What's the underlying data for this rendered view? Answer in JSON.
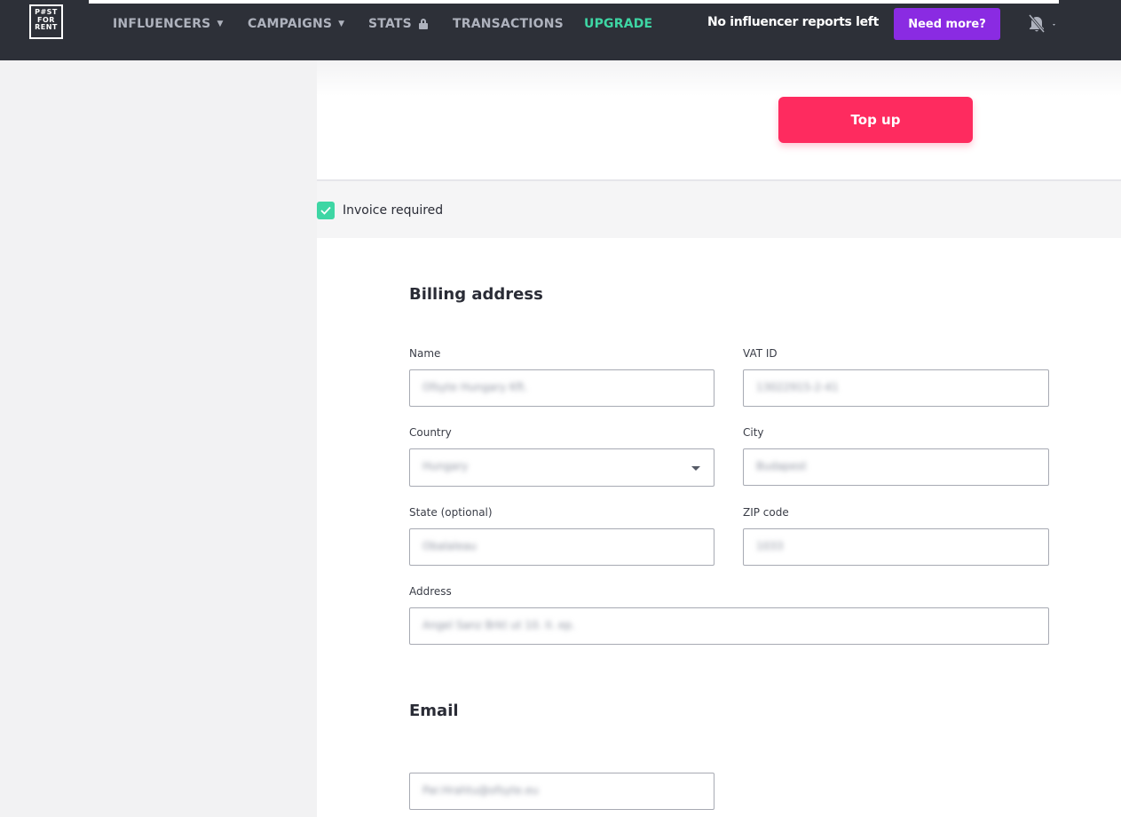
{
  "nav": {
    "logo": [
      "P#ST",
      "FOR",
      "RENT"
    ],
    "items": [
      {
        "label": "INFLUENCERS",
        "dropdown": true
      },
      {
        "label": "CAMPAIGNS",
        "dropdown": true
      },
      {
        "label": "STATS",
        "locked": true
      },
      {
        "label": "TRANSACTIONS"
      },
      {
        "label": "UPGRADE",
        "accent": "#3ed6a4"
      }
    ],
    "reports_left": "No influencer reports left",
    "need_more": "Need more?"
  },
  "topup": {
    "button": "Top up"
  },
  "invoice": {
    "label": "Invoice required",
    "checked": true
  },
  "billing": {
    "title": "Billing address",
    "name": {
      "label": "Name",
      "value": "Ofsyte Hungary Kft."
    },
    "vat": {
      "label": "VAT ID",
      "value": "13022915-2-41"
    },
    "country": {
      "label": "Country",
      "value": "Hungary"
    },
    "city": {
      "label": "City",
      "value": "Budapest"
    },
    "state": {
      "label": "State (optional)",
      "value": "Obalaleau"
    },
    "zip": {
      "label": "ZIP code",
      "value": "1033"
    },
    "address": {
      "label": "Address",
      "value": "Angel Sanz Brkt ut 10. II. ep."
    }
  },
  "email": {
    "title": "Email",
    "value": "Par.Hrahtu@ofsyte.eu"
  },
  "colors": {
    "nav_bg": "#2d3038",
    "accent_green": "#3ed6a4",
    "topup": "#fe2b5f",
    "need_more": "#8a2be2"
  }
}
